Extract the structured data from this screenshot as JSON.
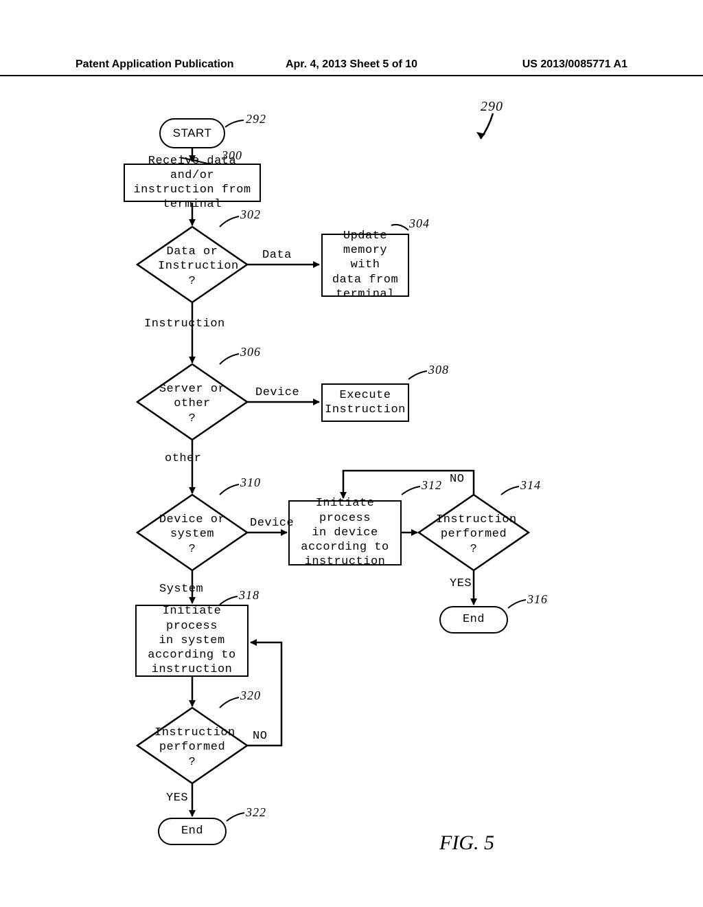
{
  "header": {
    "left": "Patent Application Publication",
    "center": "Apr. 4, 2013  Sheet 5 of 10",
    "right": "US 2013/0085771 A1"
  },
  "figure_caption": "FIG. 5",
  "refs": {
    "r290": "290",
    "r292": "292",
    "r300": "300",
    "r302": "302",
    "r304": "304",
    "r306": "306",
    "r308": "308",
    "r310": "310",
    "r312": "312",
    "r314": "314",
    "r316": "316",
    "r318": "318",
    "r320": "320",
    "r322": "322"
  },
  "nodes": {
    "start": "START",
    "n300": "Receive data and/or\ninstruction from terminal",
    "n302": "Data or\nInstruction\n?",
    "n304": "Update\nmemory with\ndata from\nterminal",
    "n306": "Server or\nother\n?",
    "n308": "Execute\nInstruction",
    "n310": "Device or\nsystem\n?",
    "n312": "Initiate process\nin device\naccording to\ninstruction",
    "n314": "Instruction\nperformed\n?",
    "n318": "Initiate process\nin system\naccording to\ninstruction",
    "n320": "Instruction\nperformed\n?",
    "end316": "End",
    "end322": "End"
  },
  "edges": {
    "e302_data": "Data",
    "e302_instr": "Instruction",
    "e306_device": "Device",
    "e306_other": "other",
    "e310_device": "Device",
    "e310_system": "System",
    "e314_no": "NO",
    "e314_yes": "YES",
    "e320_no": "NO",
    "e320_yes": "YES"
  }
}
